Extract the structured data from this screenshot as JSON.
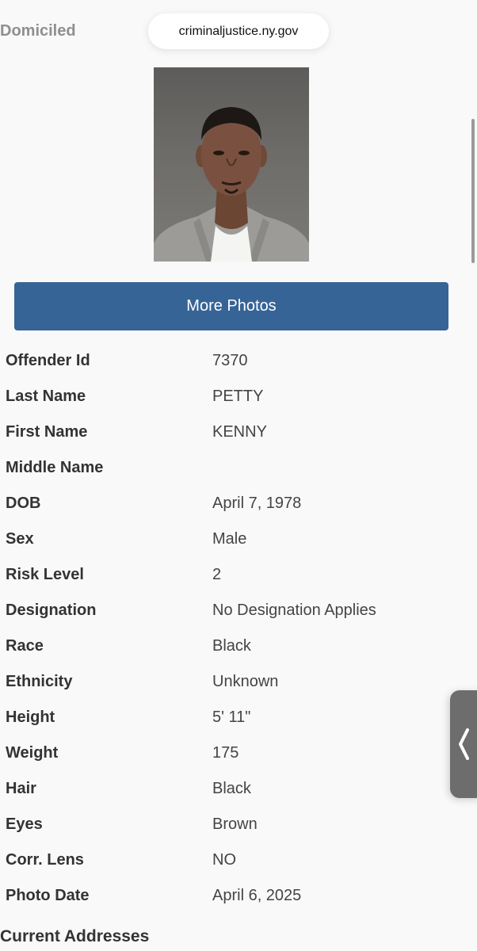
{
  "header": {
    "section_title": "Domiciled",
    "url": "criminaljustice.ny.gov"
  },
  "photo": {
    "icon": "mugshot-photo"
  },
  "more_photos_label": "More Photos",
  "details": [
    {
      "label": "Offender Id",
      "value": "7370"
    },
    {
      "label": "Last Name",
      "value": "PETTY"
    },
    {
      "label": "First Name",
      "value": "KENNY"
    },
    {
      "label": "Middle Name",
      "value": ""
    },
    {
      "label": "DOB",
      "value": "April 7, 1978"
    },
    {
      "label": "Sex",
      "value": "Male"
    },
    {
      "label": "Risk Level",
      "value": "2"
    },
    {
      "label": "Designation",
      "value": "No Designation Applies"
    },
    {
      "label": "Race",
      "value": "Black"
    },
    {
      "label": "Ethnicity",
      "value": "Unknown"
    },
    {
      "label": "Height",
      "value": "5' 11\""
    },
    {
      "label": "Weight",
      "value": "175"
    },
    {
      "label": "Hair",
      "value": "Black"
    },
    {
      "label": "Eyes",
      "value": "Brown"
    },
    {
      "label": "Corr. Lens",
      "value": "NO"
    },
    {
      "label": "Photo Date",
      "value": "April 6, 2025"
    }
  ],
  "next_section_title": "Current Addresses",
  "side_tab": {
    "icon": "chevron-left-icon"
  },
  "colors": {
    "button": "#376496",
    "background": "#f9f9f9",
    "side_tab": "#6d6d6d"
  }
}
